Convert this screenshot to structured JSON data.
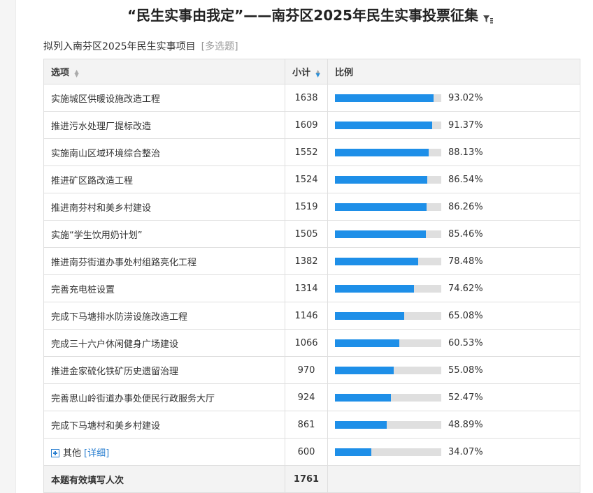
{
  "title": "“民生实事由我定”——南芬区2025年民生实事投票征集",
  "question": {
    "text": "拟列入南芬区2025年民生实事项目",
    "tag": "[多选题]"
  },
  "table": {
    "headers": {
      "option": "选项",
      "count": "小计",
      "ratio": "比例"
    },
    "rows": [
      {
        "label": "实施城区供暖设施改造工程",
        "count": "1638",
        "pct": "93.02%",
        "value": 93.02
      },
      {
        "label": "推进污水处理厂提标改造",
        "count": "1609",
        "pct": "91.37%",
        "value": 91.37
      },
      {
        "label": "实施南山区域环境综合整治",
        "count": "1552",
        "pct": "88.13%",
        "value": 88.13
      },
      {
        "label": "推进矿区路改造工程",
        "count": "1524",
        "pct": "86.54%",
        "value": 86.54
      },
      {
        "label": "推进南芬村和美乡村建设",
        "count": "1519",
        "pct": "86.26%",
        "value": 86.26
      },
      {
        "label": "实施“学生饮用奶计划”",
        "count": "1505",
        "pct": "85.46%",
        "value": 85.46
      },
      {
        "label": "推进南芬街道办事处村组路亮化工程",
        "count": "1382",
        "pct": "78.48%",
        "value": 78.48
      },
      {
        "label": "完善充电桩设置",
        "count": "1314",
        "pct": "74.62%",
        "value": 74.62
      },
      {
        "label": "完成下马塘排水防涝设施改造工程",
        "count": "1146",
        "pct": "65.08%",
        "value": 65.08
      },
      {
        "label": "完成三十六户休闲健身广场建设",
        "count": "1066",
        "pct": "60.53%",
        "value": 60.53
      },
      {
        "label": "推进金家硫化铁矿历史遗留治理",
        "count": "970",
        "pct": "55.08%",
        "value": 55.08
      },
      {
        "label": "完善思山岭街道办事处便民行政服务大厅",
        "count": "924",
        "pct": "52.47%",
        "value": 52.47
      },
      {
        "label": "完成下马塘村和美乡村建设",
        "count": "861",
        "pct": "48.89%",
        "value": 48.89
      }
    ],
    "other": {
      "label": "其他",
      "detail": "[详细]",
      "count": "600",
      "pct": "34.07%",
      "value": 34.07
    },
    "total": {
      "label": "本题有效填写人次",
      "count": "1761"
    }
  },
  "colors": {
    "bar_fill": "#1e8fe8",
    "bar_track": "#dfdfdf",
    "link": "#2a7fd0"
  }
}
